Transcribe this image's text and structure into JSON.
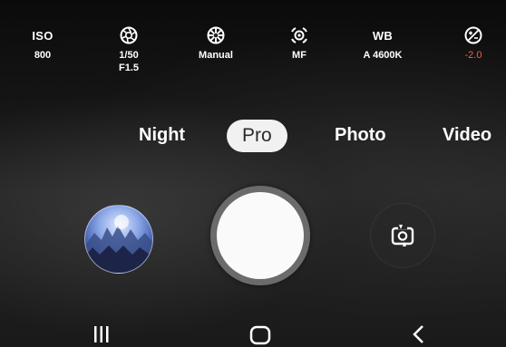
{
  "settings": {
    "iso": {
      "label": "ISO",
      "value": "800"
    },
    "shutter_speed": {
      "icon": "aperture-icon",
      "value": "1/50",
      "value2": "F1.5"
    },
    "focus_mode": {
      "icon": "focus-wheel-icon",
      "value": "Manual"
    },
    "focus": {
      "icon": "focus-target-icon",
      "value": "MF"
    },
    "white_balance": {
      "label": "WB",
      "value": "A 4600K"
    },
    "exposure": {
      "icon": "exposure-icon",
      "value": "-2.0",
      "value_color": "#ff5a45"
    }
  },
  "modes": [
    {
      "label": "Night"
    },
    {
      "label": "Pro",
      "active": true
    },
    {
      "label": "Photo"
    },
    {
      "label": "Video"
    }
  ],
  "controls": {
    "gallery_icon": "gallery-thumbnail",
    "shutter_icon": "shutter-button",
    "flip_icon": "flip-camera-icon"
  },
  "navigation": {
    "recent_icon": "recent-apps-icon",
    "home_icon": "home-icon",
    "back_icon": "back-icon"
  }
}
